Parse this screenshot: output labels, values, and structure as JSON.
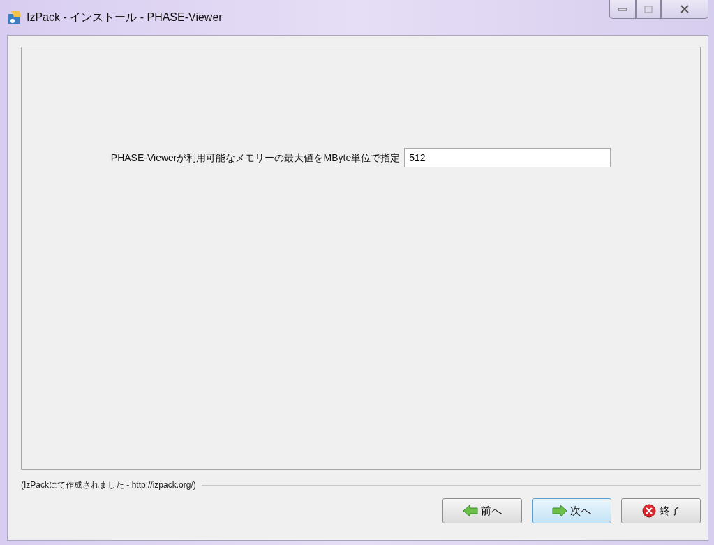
{
  "window": {
    "title": "IzPack - インストール - PHASE-Viewer"
  },
  "panel": {
    "label": "PHASE-Viewerが利用可能なメモリーの最大値をMByte単位で指定",
    "value": "512"
  },
  "footer": {
    "credit": "(IzPackにて作成されました - http://izpack.org/)"
  },
  "buttons": [
    {
      "label": "前へ",
      "kind": "back",
      "focused": false
    },
    {
      "label": "次へ",
      "kind": "next",
      "focused": true
    },
    {
      "label": "終了",
      "kind": "quit",
      "focused": false
    }
  ]
}
